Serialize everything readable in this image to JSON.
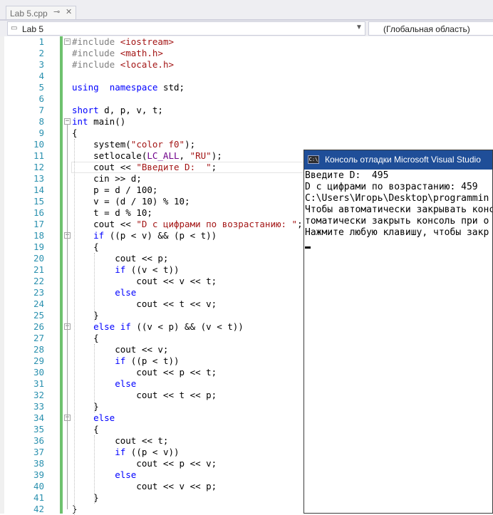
{
  "tab": {
    "title": "Lab 5.cpp",
    "pin": "⊸",
    "close": "✕"
  },
  "navbar": {
    "project": "Lab 5",
    "scope": "(Глобальная область)"
  },
  "editor": {
    "lines": [
      {
        "n": "1",
        "t": [
          [
            "pp",
            "#include "
          ],
          [
            "str",
            "<iostream>"
          ]
        ]
      },
      {
        "n": "2",
        "t": [
          [
            "pp",
            "#include "
          ],
          [
            "str",
            "<math.h>"
          ]
        ]
      },
      {
        "n": "3",
        "t": [
          [
            "pp",
            "#include "
          ],
          [
            "str",
            "<locale.h>"
          ]
        ]
      },
      {
        "n": "4",
        "t": []
      },
      {
        "n": "5",
        "t": [
          [
            "kw",
            "using"
          ],
          [
            "",
            "  "
          ],
          [
            "kw",
            "namespace"
          ],
          [
            "",
            " std;"
          ]
        ]
      },
      {
        "n": "6",
        "t": []
      },
      {
        "n": "7",
        "t": [
          [
            "kw",
            "short"
          ],
          [
            "",
            " d, p, v, t;"
          ]
        ]
      },
      {
        "n": "8",
        "t": [
          [
            "kw",
            "int"
          ],
          [
            "",
            " main()"
          ]
        ]
      },
      {
        "n": "9",
        "t": [
          [
            "",
            "{"
          ]
        ]
      },
      {
        "n": "10",
        "t": [
          [
            "",
            "    system("
          ],
          [
            "str",
            "\"color f0\""
          ],
          [
            "",
            ");"
          ]
        ]
      },
      {
        "n": "11",
        "t": [
          [
            "",
            "    setlocale("
          ],
          [
            "mac",
            "LC_ALL"
          ],
          [
            "",
            ", "
          ],
          [
            "str",
            "\"RU\""
          ],
          [
            "",
            ");"
          ]
        ]
      },
      {
        "n": "12",
        "t": [
          [
            "",
            "    cout << "
          ],
          [
            "str",
            "\"Введите D:  \""
          ],
          [
            "",
            ";"
          ]
        ]
      },
      {
        "n": "13",
        "t": [
          [
            "",
            "    cin >> d;"
          ]
        ]
      },
      {
        "n": "14",
        "t": [
          [
            "",
            "    p = d / 100;"
          ]
        ]
      },
      {
        "n": "15",
        "t": [
          [
            "",
            "    v = (d / 10) % 10;"
          ]
        ]
      },
      {
        "n": "16",
        "t": [
          [
            "",
            "    t = d % 10;"
          ]
        ]
      },
      {
        "n": "17",
        "t": [
          [
            "",
            "    cout << "
          ],
          [
            "str",
            "\"D с цифрами по возрастанию: \""
          ],
          [
            "",
            ";"
          ]
        ]
      },
      {
        "n": "18",
        "t": [
          [
            "",
            "    "
          ],
          [
            "kw",
            "if"
          ],
          [
            "",
            " ((p < v) && (p < t))"
          ]
        ]
      },
      {
        "n": "19",
        "t": [
          [
            "",
            "    {"
          ]
        ]
      },
      {
        "n": "20",
        "t": [
          [
            "",
            "        cout << p;"
          ]
        ]
      },
      {
        "n": "21",
        "t": [
          [
            "",
            "        "
          ],
          [
            "kw",
            "if"
          ],
          [
            "",
            " ((v < t))"
          ]
        ]
      },
      {
        "n": "22",
        "t": [
          [
            "",
            "            cout << v << t;"
          ]
        ]
      },
      {
        "n": "23",
        "t": [
          [
            "",
            "        "
          ],
          [
            "kw",
            "else"
          ]
        ]
      },
      {
        "n": "24",
        "t": [
          [
            "",
            "            cout << t << v;"
          ]
        ]
      },
      {
        "n": "25",
        "t": [
          [
            "",
            "    }"
          ]
        ]
      },
      {
        "n": "26",
        "t": [
          [
            "",
            "    "
          ],
          [
            "kw",
            "else if"
          ],
          [
            "",
            " ((v < p) && (v < t))"
          ]
        ]
      },
      {
        "n": "27",
        "t": [
          [
            "",
            "    {"
          ]
        ]
      },
      {
        "n": "28",
        "t": [
          [
            "",
            "        cout << v;"
          ]
        ]
      },
      {
        "n": "29",
        "t": [
          [
            "",
            "        "
          ],
          [
            "kw",
            "if"
          ],
          [
            "",
            " ((p < t))"
          ]
        ]
      },
      {
        "n": "30",
        "t": [
          [
            "",
            "            cout << p << t;"
          ]
        ]
      },
      {
        "n": "31",
        "t": [
          [
            "",
            "        "
          ],
          [
            "kw",
            "else"
          ]
        ]
      },
      {
        "n": "32",
        "t": [
          [
            "",
            "            cout << t << p;"
          ]
        ]
      },
      {
        "n": "33",
        "t": [
          [
            "",
            "    }"
          ]
        ]
      },
      {
        "n": "34",
        "t": [
          [
            "",
            "    "
          ],
          [
            "kw",
            "else"
          ]
        ]
      },
      {
        "n": "35",
        "t": [
          [
            "",
            "    {"
          ]
        ]
      },
      {
        "n": "36",
        "t": [
          [
            "",
            "        cout << t;"
          ]
        ]
      },
      {
        "n": "37",
        "t": [
          [
            "",
            "        "
          ],
          [
            "kw",
            "if"
          ],
          [
            "",
            " ((p < v))"
          ]
        ]
      },
      {
        "n": "38",
        "t": [
          [
            "",
            "            cout << p << v;"
          ]
        ]
      },
      {
        "n": "39",
        "t": [
          [
            "",
            "        "
          ],
          [
            "kw",
            "else"
          ]
        ]
      },
      {
        "n": "40",
        "t": [
          [
            "",
            "            cout << v << p;"
          ]
        ]
      },
      {
        "n": "41",
        "t": [
          [
            "",
            "    }"
          ]
        ]
      },
      {
        "n": "42",
        "t": [
          [
            "",
            "}"
          ]
        ]
      }
    ]
  },
  "console": {
    "icon": "C:\\",
    "title": "Консоль отладки Microsoft Visual Studio",
    "lines": [
      "Введите D:  495",
      "D с цифрами по возрастанию: 459",
      "C:\\Users\\Игорь\\Desktop\\programmin",
      "Чтобы автоматически закрывать конс",
      "томатически закрыть консоль при о",
      "Нажмите любую клавишу, чтобы закр"
    ]
  }
}
